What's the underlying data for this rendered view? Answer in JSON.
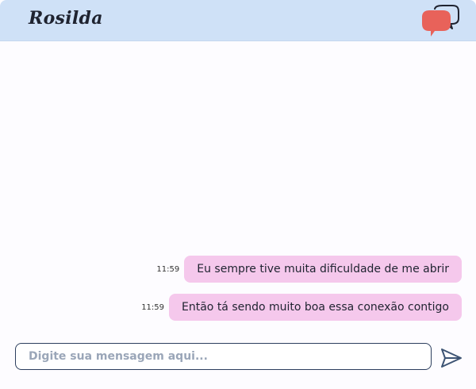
{
  "header": {
    "title": "Rosilda",
    "logo_icon": "chat-bubbles-icon",
    "logo_colors": {
      "front": "#e8625a",
      "back_outline": "#1f2330"
    }
  },
  "messages": [
    {
      "time": "11:59",
      "text": "Eu sempre tive muita dificuldade de me abrir"
    },
    {
      "time": "11:59",
      "text": "Então tá sendo muito boa essa conexão contigo"
    }
  ],
  "composer": {
    "placeholder": "Digite sua mensagem aqui...",
    "value": "",
    "send_icon": "send-icon"
  },
  "colors": {
    "header_bg": "#cfe1f7",
    "bubble_bg": "#f5c8ec",
    "input_border": "#2c3e5e",
    "send_icon": "#3d5474"
  }
}
